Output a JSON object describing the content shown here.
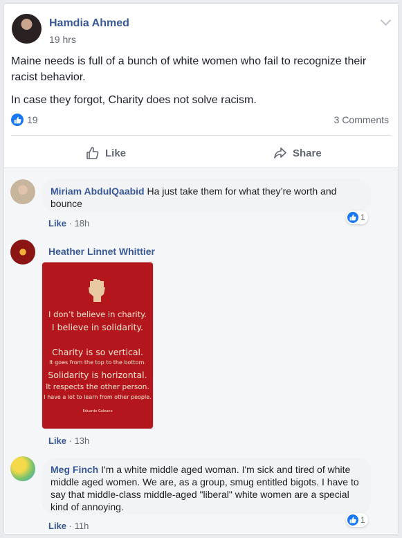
{
  "post": {
    "author": "Hamdia Ahmed",
    "time": "19 hrs",
    "paragraphs": [
      "Maine needs is full of a bunch of white women who fail to recognize their racist behavior.",
      "In case they forgot, Charity does not solve racism."
    ],
    "reaction_count": "19",
    "comments_count": "3 Comments"
  },
  "actions": {
    "like": "Like",
    "share": "Share"
  },
  "comments": [
    {
      "name": "Miriam AbdulQaabid",
      "text": "Ha just take them for what they’re worth and bounce",
      "like": "Like",
      "sep": " · ",
      "time": "18h",
      "reactions": "1"
    },
    {
      "name": "Heather Linnet Whittier",
      "like": "Like",
      "sep": " · ",
      "time": "13h",
      "image": {
        "lines": [
          "I don’t believe in charity.",
          "I believe in solidarity.",
          "Charity is so vertical.",
          "It goes from the top to the bottom.",
          "Solidarity is horizontal.",
          "It respects the other person.",
          "I have a lot to learn from other people.",
          "Eduardo Galeano"
        ]
      }
    },
    {
      "name": "Meg Finch",
      "text": "I'm a white middle aged woman. I'm sick and tired of white middle aged women. We are, as a group, smug entitled bigots. I have to say that middle-class middle-aged \"liberal\" white women are a special kind of annoying.",
      "like": "Like",
      "sep": " · ",
      "time": "11h",
      "reactions": "1"
    }
  ],
  "colors": {
    "link": "#385898",
    "like_blue": "#1877f2",
    "poster_red": "#b3171d"
  }
}
